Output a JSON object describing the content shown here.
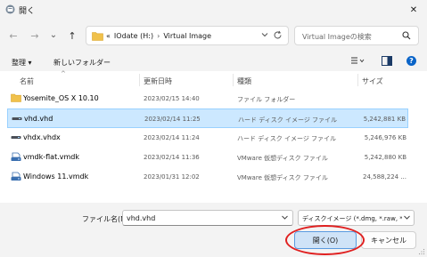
{
  "window": {
    "title": "開く",
    "close_symbol": "✕"
  },
  "nav": {
    "back": "←",
    "forward": "→",
    "recent": "⌄",
    "up": "↑",
    "address": {
      "prefix": "«",
      "segments": [
        "IOdate (H:)",
        "Virtual Image"
      ],
      "separator": "›"
    },
    "search_placeholder": "Virtual Imageの検索"
  },
  "toolbar": {
    "organize": "整理 ▾",
    "new_folder": "新しいフォルダー",
    "help": "?"
  },
  "columns": {
    "name": "名前",
    "date": "更新日時",
    "type": "種類",
    "size": "サイズ",
    "sort_indicator": "^"
  },
  "files": [
    {
      "name": "Yosemite_OS X 10.10",
      "date": "2023/02/15 14:40",
      "type": "ファイル フォルダー",
      "size": "",
      "icon": "folder-icon",
      "selected": false
    },
    {
      "name": "vhd.vhd",
      "date": "2023/02/14 11:25",
      "type": "ハード ディスク イメージ ファイル",
      "size": "5,242,881 KB",
      "icon": "disk-image-icon",
      "selected": true
    },
    {
      "name": "vhdx.vhdx",
      "date": "2023/02/14 11:24",
      "type": "ハード ディスク イメージ ファイル",
      "size": "5,246,976 KB",
      "icon": "disk-image-icon",
      "selected": false
    },
    {
      "name": "vmdk-flat.vmdk",
      "date": "2023/02/14 11:36",
      "type": "VMware 仮想ディスク ファイル",
      "size": "5,242,880 KB",
      "icon": "vmware-disk-icon",
      "selected": false
    },
    {
      "name": "Windows 11.vmdk",
      "date": "2023/01/31 12:02",
      "type": "VMware 仮想ディスク ファイル",
      "size": "24,588,224 ...",
      "icon": "vmware-disk-icon",
      "selected": false
    }
  ],
  "footer": {
    "filename_label": "ファイル名(N):",
    "filename_value": "vhd.vhd",
    "filetype_value": "ディスクイメージ (*.dmg, *.raw, *.dd",
    "open_label": "開く(O)",
    "cancel_label": "キャンセル"
  },
  "colors": {
    "selection": "#cce8ff",
    "accent": "#0a64c8",
    "highlight_ring": "#e02020"
  }
}
